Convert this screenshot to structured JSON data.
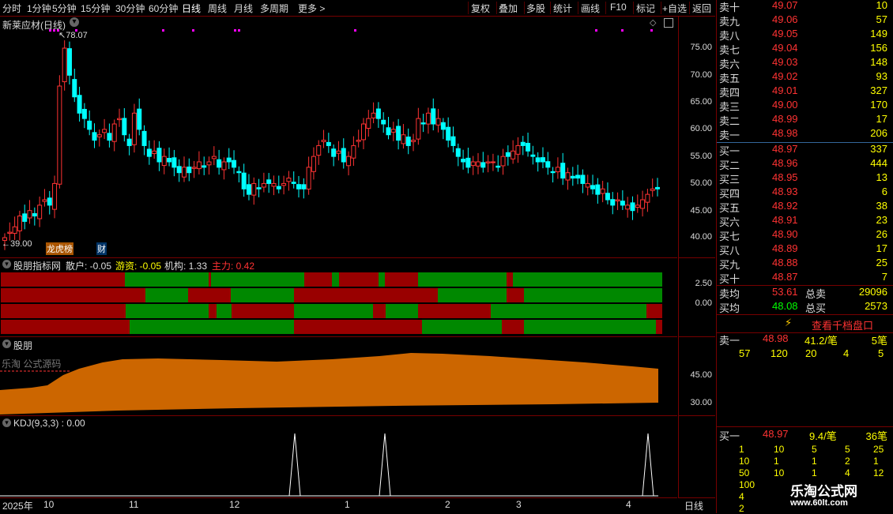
{
  "toolbar": {
    "periods": [
      "分时",
      "1分钟",
      "5分钟",
      "15分钟",
      "30分钟",
      "60分钟",
      "日线",
      "周线",
      "月线",
      "多周期",
      "更多 >"
    ],
    "active_period": "日线",
    "tools": [
      "复权",
      "叠加",
      "多股",
      "统计",
      "画线",
      "F10",
      "标记",
      "+自选",
      "返回"
    ]
  },
  "main_chart": {
    "title": "新莱应材(日线)",
    "high_label": "78.07",
    "low_label": "39.00",
    "tags": [
      "龙虎榜",
      "财"
    ],
    "y_ticks": [
      "75.00",
      "70.00",
      "65.00",
      "60.00",
      "55.00",
      "50.00",
      "45.00",
      "40.00"
    ]
  },
  "indicator1": {
    "title": "股朋指标网",
    "values": [
      {
        "label": "散户: -0.05",
        "color": "#dddddd"
      },
      {
        "label": "游资: -0.05",
        "color": "#ffff00"
      },
      {
        "label": "机构: 1.33",
        "color": "#dddddd"
      },
      {
        "label": "主力: 0.42",
        "color": "#ff3333"
      }
    ],
    "y_ticks": [
      "2.50",
      "0.00"
    ]
  },
  "indicator2": {
    "title": "股朋",
    "watermark": "乐淘 公式源码",
    "y_ticks": [
      "45.00",
      "30.00"
    ]
  },
  "indicator3": {
    "title": "KDJ(9,3,3) : 0.00"
  },
  "x_axis": {
    "labels": [
      "2025年",
      "10",
      "11",
      "12",
      "1",
      "2",
      "3",
      "4"
    ],
    "period_label": "日线"
  },
  "order_book": {
    "asks": [
      {
        "label": "卖十",
        "price": "49.07",
        "vol": "10"
      },
      {
        "label": "卖九",
        "price": "49.06",
        "vol": "57"
      },
      {
        "label": "卖八",
        "price": "49.05",
        "vol": "149"
      },
      {
        "label": "卖七",
        "price": "49.04",
        "vol": "156"
      },
      {
        "label": "卖六",
        "price": "49.03",
        "vol": "148"
      },
      {
        "label": "卖五",
        "price": "49.02",
        "vol": "93"
      },
      {
        "label": "卖四",
        "price": "49.01",
        "vol": "327"
      },
      {
        "label": "卖三",
        "price": "49.00",
        "vol": "170"
      },
      {
        "label": "卖二",
        "price": "48.99",
        "vol": "17"
      },
      {
        "label": "卖一",
        "price": "48.98",
        "vol": "206"
      }
    ],
    "bids": [
      {
        "label": "买一",
        "price": "48.97",
        "vol": "337"
      },
      {
        "label": "买二",
        "price": "48.96",
        "vol": "444"
      },
      {
        "label": "买三",
        "price": "48.95",
        "vol": "13"
      },
      {
        "label": "买四",
        "price": "48.93",
        "vol": "6"
      },
      {
        "label": "买五",
        "price": "48.92",
        "vol": "38"
      },
      {
        "label": "买六",
        "price": "48.91",
        "vol": "23"
      },
      {
        "label": "买七",
        "price": "48.90",
        "vol": "26"
      },
      {
        "label": "买八",
        "price": "48.89",
        "vol": "17"
      },
      {
        "label": "买九",
        "price": "48.88",
        "vol": "25"
      },
      {
        "label": "买十",
        "price": "48.87",
        "vol": "7"
      }
    ],
    "avg_sell_label": "卖均",
    "avg_sell": "53.61",
    "total_sell_label": "总卖",
    "total_sell": "29096",
    "avg_buy_label": "买均",
    "avg_buy": "48.08",
    "total_buy_label": "总买",
    "total_buy": "2573",
    "view_button": "查看千档盘口",
    "ask1_detail": {
      "label": "卖一",
      "price": "48.98",
      "size": "41.2/笔",
      "count": "5笔",
      "queue": [
        "57",
        "120",
        "20",
        "4",
        "5"
      ]
    },
    "bid1_detail": {
      "label": "买一",
      "price": "48.97",
      "size": "9.4/笔",
      "count": "36笔",
      "rows": [
        [
          "1",
          "10",
          "5",
          "5",
          "25"
        ],
        [
          "10",
          "1",
          "1",
          "2",
          "1"
        ],
        [
          "50",
          "10",
          "1",
          "4",
          "12"
        ],
        [
          "100"
        ],
        [
          "4"
        ],
        [
          "2"
        ]
      ]
    }
  },
  "watermark": {
    "name": "乐淘公式网",
    "url": "www.60lt.com"
  },
  "colors": {
    "up": "#ff3333",
    "down": "#00ffff",
    "red_bar": "#990000",
    "green_bar": "#008800",
    "orange": "#cc6600",
    "grid": "#770000"
  }
}
